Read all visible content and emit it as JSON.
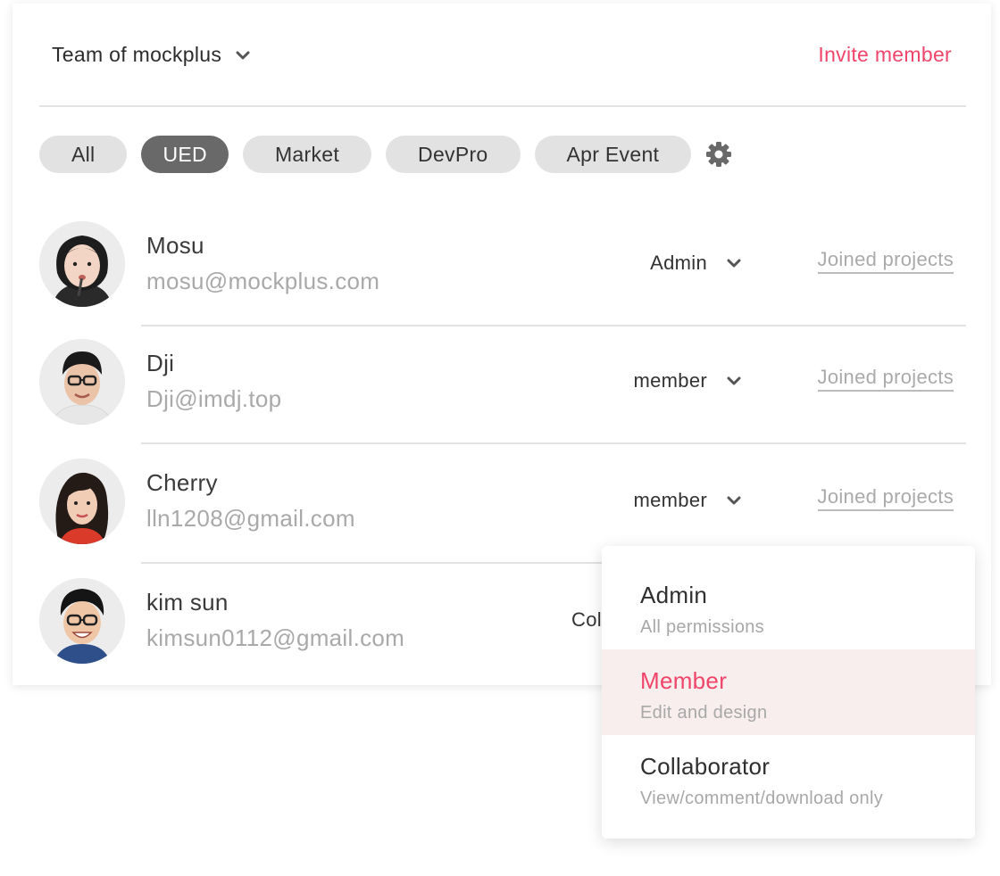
{
  "header": {
    "team_name": "Team of mockplus",
    "team_icon": "chevron-down-icon",
    "invite_label": "Invite member"
  },
  "groups": {
    "tags": [
      {
        "label": "All",
        "active": false
      },
      {
        "label": "UED",
        "active": true
      },
      {
        "label": "Market",
        "active": false
      },
      {
        "label": "DevPro",
        "active": false
      },
      {
        "label": "Apr Event",
        "active": false
      }
    ],
    "settings_icon": "gear-icon"
  },
  "members": [
    {
      "name": "Mosu",
      "email": "mosu@mockplus.com",
      "role": "Admin",
      "joined_label": "Joined projects"
    },
    {
      "name": "Dji",
      "email": "Dji@imdj.top",
      "role": "member",
      "joined_label": "Joined projects"
    },
    {
      "name": "Cherry",
      "email": "lln1208@gmail.com",
      "role": "member",
      "joined_label": "Joined projects"
    },
    {
      "name": "kim sun",
      "email": "kimsun0112@gmail.com",
      "role": "Col"
    }
  ],
  "role_dropdown": {
    "options": [
      {
        "title": "Admin",
        "desc": "All permissions",
        "selected": false
      },
      {
        "title": "Member",
        "desc": "Edit and design",
        "selected": true
      },
      {
        "title": "Collaborator",
        "desc": "View/comment/download only",
        "selected": false
      }
    ]
  },
  "colors": {
    "accent": "#f0456a",
    "active_tag": "#696969",
    "tag_bg": "#e2e2e2",
    "selected_option_bg": "#f8eeee"
  }
}
